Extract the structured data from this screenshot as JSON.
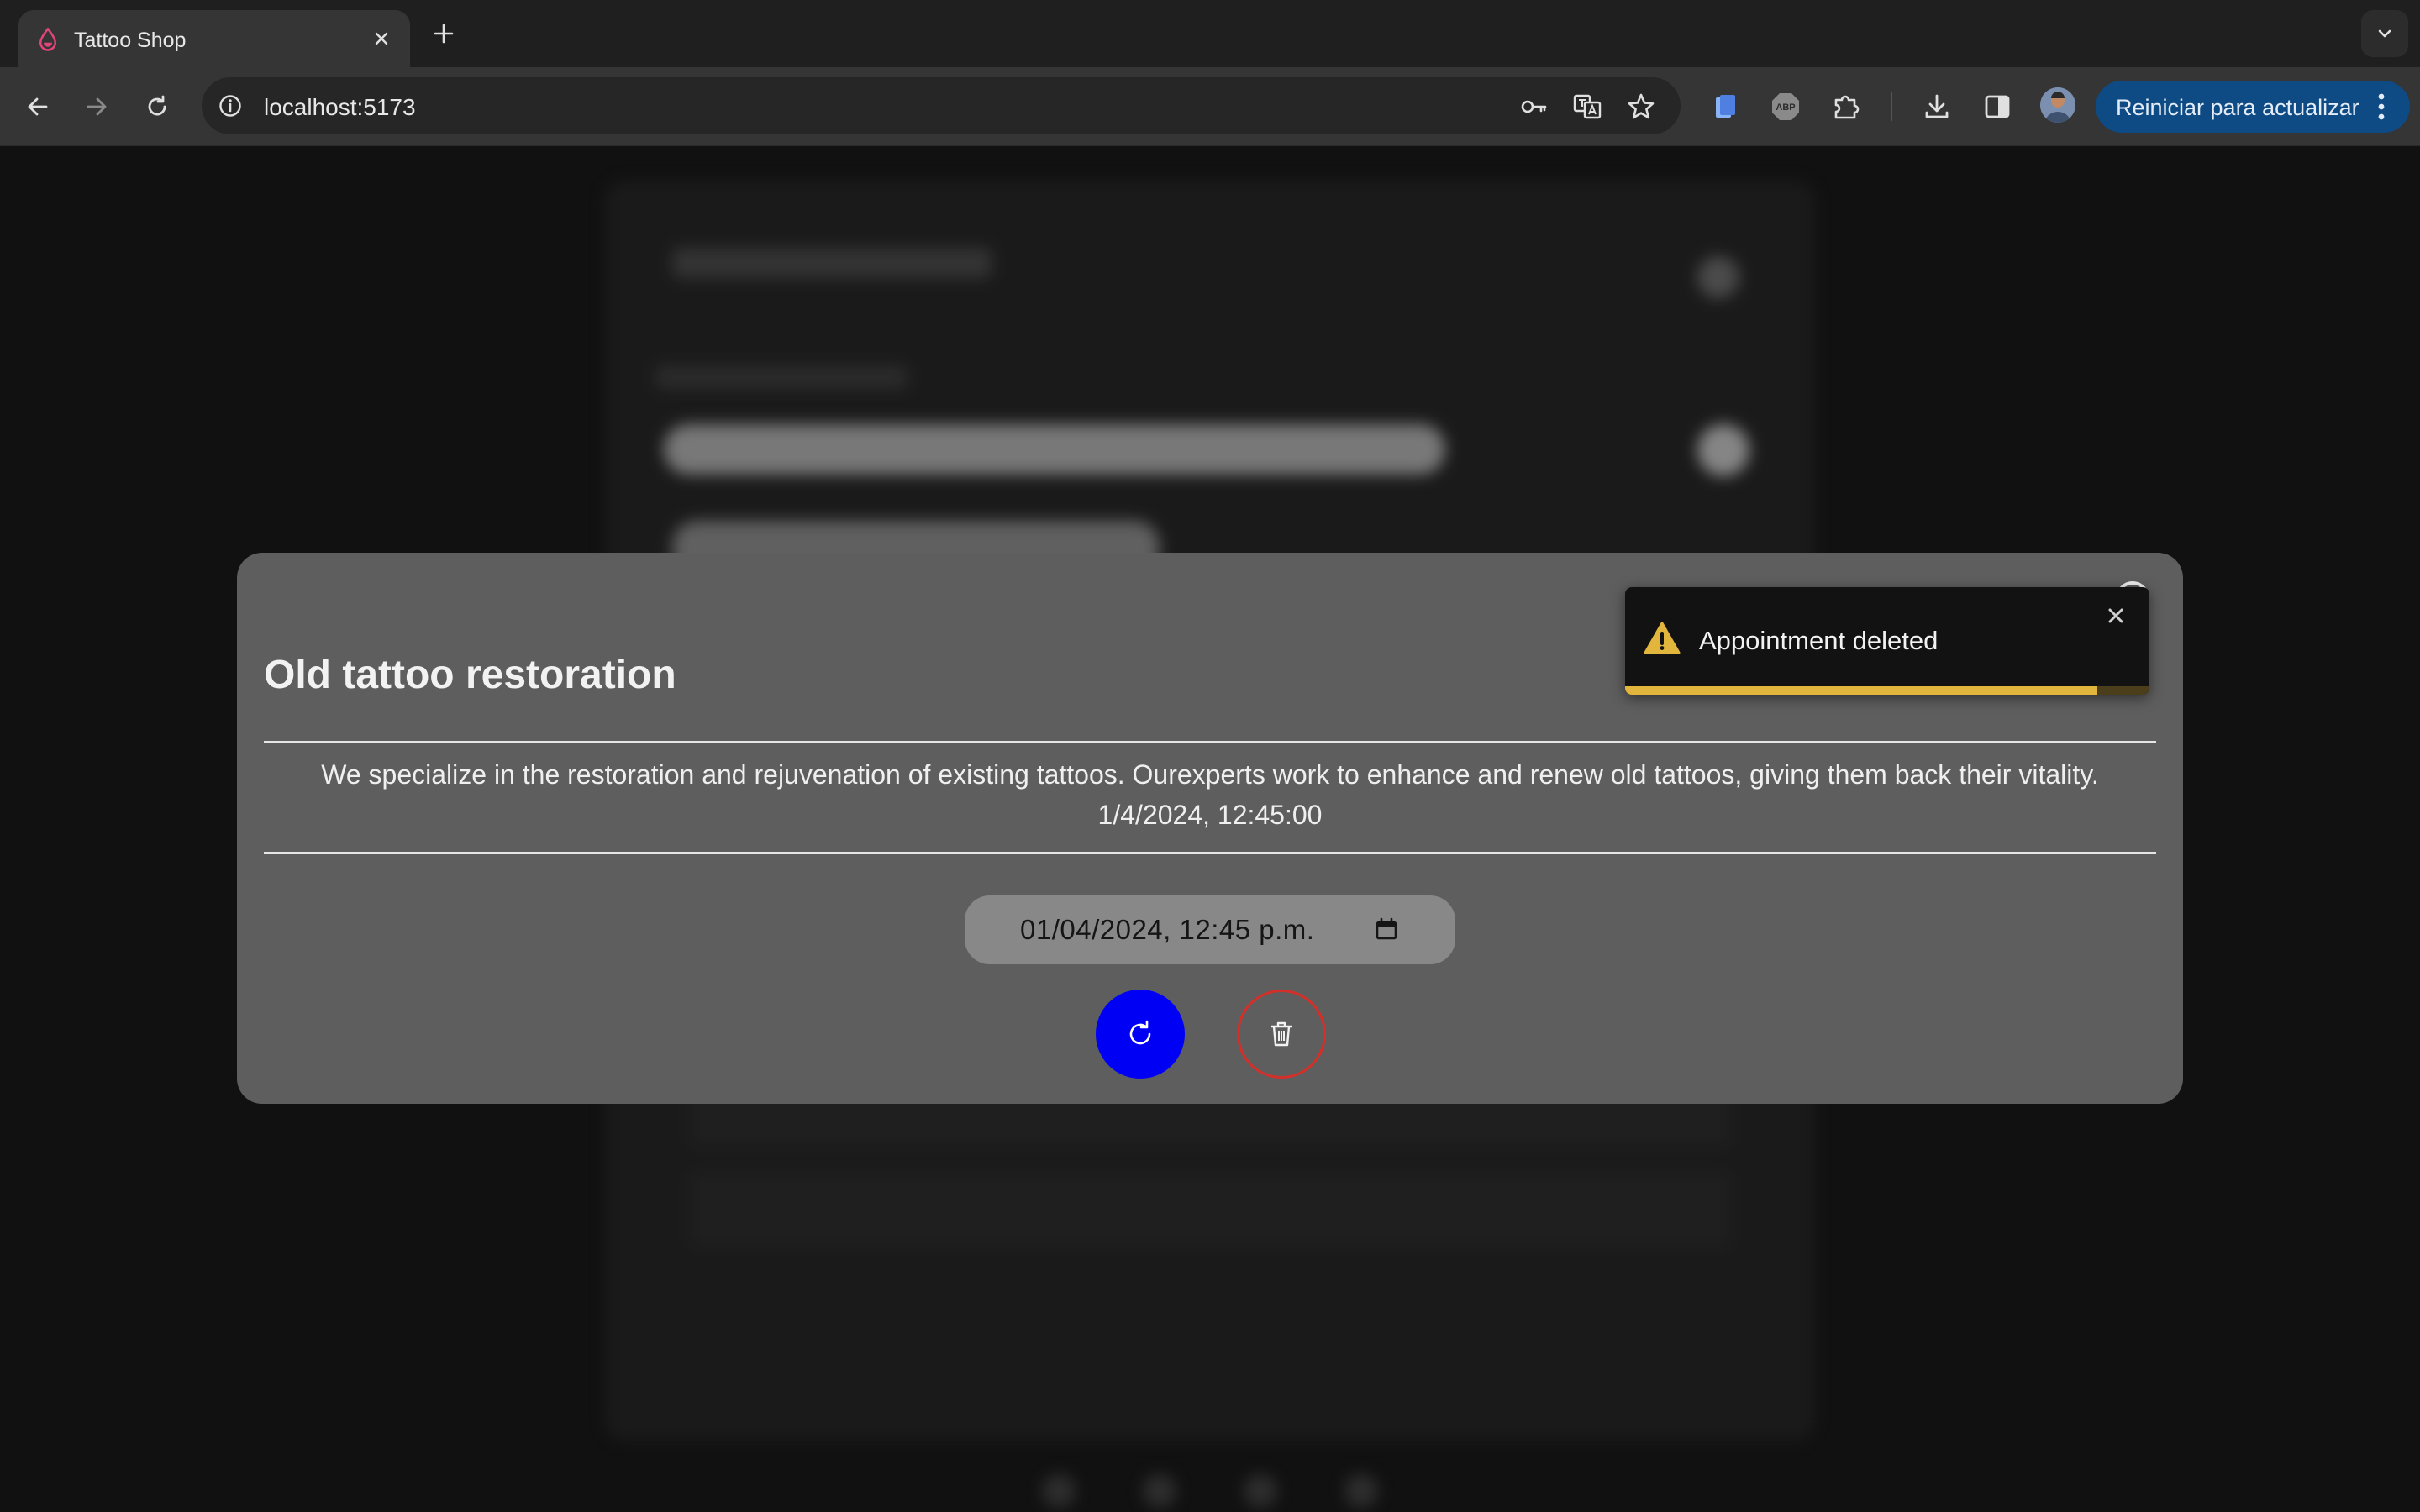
{
  "browser": {
    "tab_title": "Tattoo Shop",
    "url": "localhost:5173",
    "update_button_label": "Reiniciar para actualizar"
  },
  "modal": {
    "title": "Old tattoo restoration",
    "description": "We specialize in the restoration and rejuvenation of existing tattoos. Ourexperts work to enhance and renew old tattoos, giving them back their vitality.",
    "date": "1/4/2024, 12:45:00",
    "datetime_input_value": "01/04/2024, 12:45 p.m.",
    "update_color": "#0000f5",
    "delete_color": "#d4302a"
  },
  "toast": {
    "message": "Appointment deleted",
    "type": "warning",
    "progress": 0.9,
    "accent_color": "#e2b53d"
  }
}
